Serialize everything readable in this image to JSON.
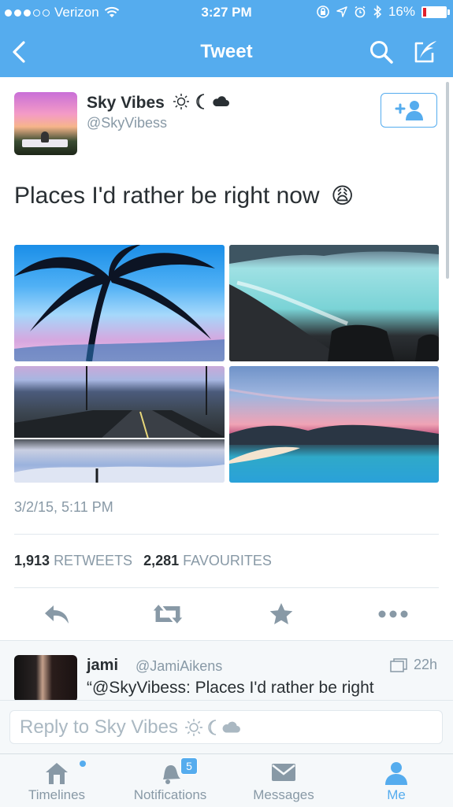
{
  "status_bar": {
    "carrier": "Verizon",
    "time": "3:27 PM",
    "battery": "16%",
    "battery_level": 0.16
  },
  "nav": {
    "title": "Tweet",
    "back_icon": "chevron-left-icon",
    "search_icon": "search-icon",
    "compose_icon": "compose-icon"
  },
  "tweet": {
    "display_name": "Sky Vibes",
    "handle": "@SkyVibess",
    "text": "Places I'd rather be right now",
    "emoji": "😩",
    "timestamp": "3/2/15, 5:11 PM",
    "retweets_count": "1,913",
    "retweets_label": "RETWEETS",
    "favourites_count": "2,281",
    "favourites_label": "FAVOURITES"
  },
  "reply": {
    "name": "jami",
    "handle": "@JamiAikens",
    "time": "22h",
    "text": "“@SkyVibess: Places I'd rather be right"
  },
  "compose": {
    "placeholder": "Reply to Sky Vibes"
  },
  "tabs": [
    {
      "label": "Timelines"
    },
    {
      "label": "Notifications",
      "badge": "5"
    },
    {
      "label": "Messages"
    },
    {
      "label": "Me"
    }
  ],
  "colors": {
    "brand": "#55acee",
    "text": "#292f33",
    "muted": "#8899a6",
    "battery_low": "#e0202a"
  }
}
